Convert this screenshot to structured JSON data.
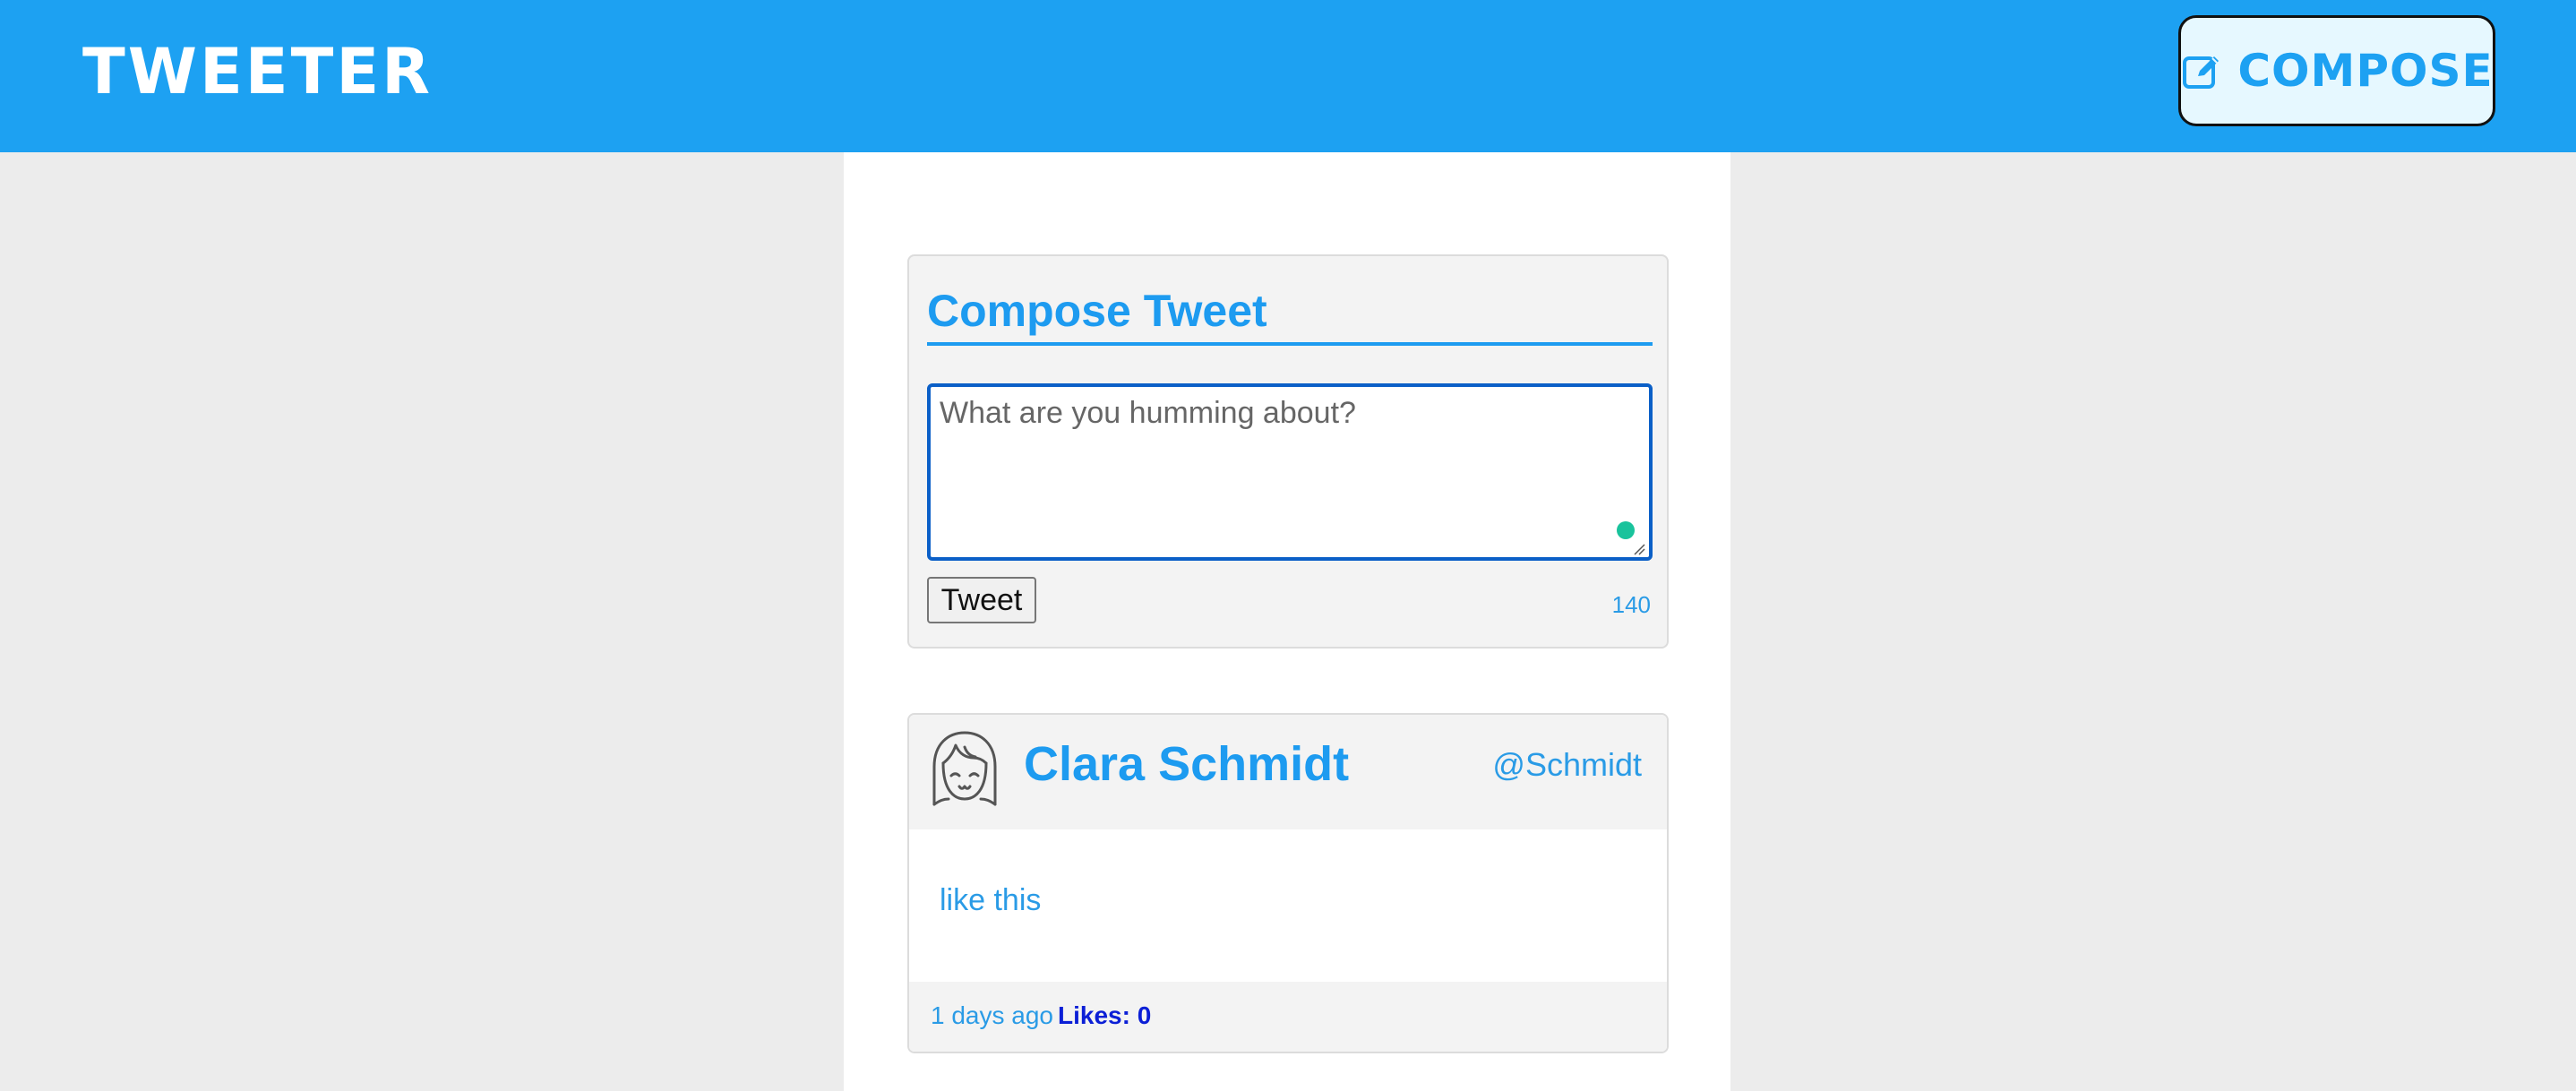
{
  "header": {
    "brand": "TWEETER",
    "compose_label": "COMPOSE",
    "compose_icon": "edit-icon",
    "bar_color": "#1da1f2"
  },
  "compose": {
    "title": "Compose Tweet",
    "placeholder": "What are you humming about?",
    "value": "",
    "submit_label": "Tweet",
    "char_count": "140"
  },
  "tweets": [
    {
      "name": "Clara Schmidt",
      "handle": "@Schmidt",
      "avatar_icon": "girl-avatar-icon",
      "text": "like this",
      "time": "1 days ago",
      "likes": "Likes: 0"
    }
  ],
  "colors": {
    "accent": "#1d9bf0",
    "likes": "#0b1fd6",
    "status_dot": "#19c39c"
  }
}
